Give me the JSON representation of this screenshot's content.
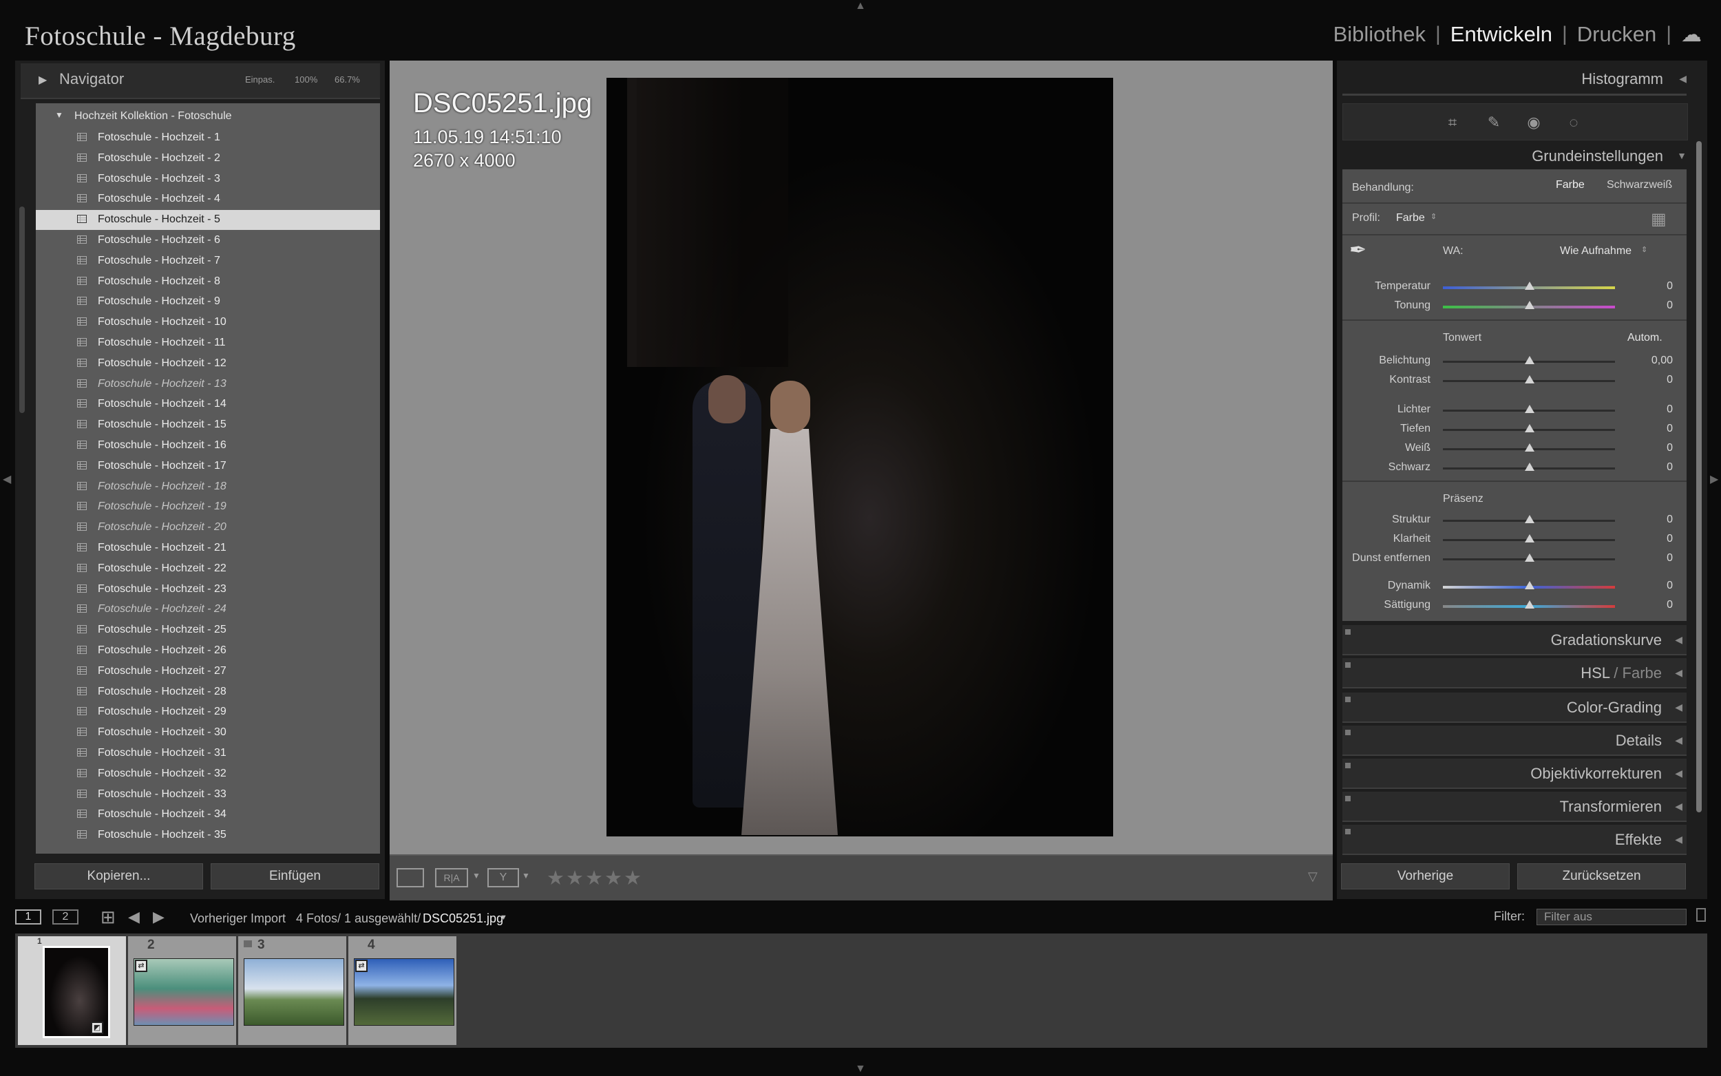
{
  "app_title": "Fotoschule - Magdeburg",
  "modules": [
    "Bibliothek",
    "Entwickeln",
    "Drucken"
  ],
  "active_module": "Entwickeln",
  "navigator": {
    "title": "Navigator",
    "zoom_options": [
      "Einpas.",
      "100%",
      "66.7%"
    ]
  },
  "collection": {
    "name": "Hochzeit Kollektion - Fotoschule",
    "items": [
      {
        "label": "Fotoschule - Hochzeit - 1",
        "italic": false
      },
      {
        "label": "Fotoschule - Hochzeit - 2",
        "italic": false
      },
      {
        "label": "Fotoschule - Hochzeit - 3",
        "italic": false
      },
      {
        "label": "Fotoschule - Hochzeit - 4",
        "italic": false
      },
      {
        "label": "Fotoschule - Hochzeit - 5",
        "italic": false,
        "selected": true
      },
      {
        "label": "Fotoschule - Hochzeit - 6",
        "italic": false
      },
      {
        "label": "Fotoschule - Hochzeit - 7",
        "italic": false
      },
      {
        "label": "Fotoschule - Hochzeit - 8",
        "italic": false
      },
      {
        "label": "Fotoschule - Hochzeit - 9",
        "italic": false
      },
      {
        "label": "Fotoschule - Hochzeit - 10",
        "italic": false
      },
      {
        "label": "Fotoschule - Hochzeit - 11",
        "italic": false
      },
      {
        "label": "Fotoschule - Hochzeit - 12",
        "italic": false
      },
      {
        "label": "Fotoschule - Hochzeit - 13",
        "italic": true
      },
      {
        "label": "Fotoschule - Hochzeit - 14",
        "italic": false
      },
      {
        "label": "Fotoschule - Hochzeit - 15",
        "italic": false
      },
      {
        "label": "Fotoschule - Hochzeit - 16",
        "italic": false
      },
      {
        "label": "Fotoschule - Hochzeit - 17",
        "italic": false
      },
      {
        "label": "Fotoschule - Hochzeit - 18",
        "italic": true
      },
      {
        "label": "Fotoschule - Hochzeit - 19",
        "italic": true
      },
      {
        "label": "Fotoschule - Hochzeit - 20",
        "italic": true
      },
      {
        "label": "Fotoschule - Hochzeit - 21",
        "italic": false
      },
      {
        "label": "Fotoschule - Hochzeit - 22",
        "italic": false
      },
      {
        "label": "Fotoschule - Hochzeit - 23",
        "italic": false
      },
      {
        "label": "Fotoschule - Hochzeit - 24",
        "italic": true
      },
      {
        "label": "Fotoschule - Hochzeit - 25",
        "italic": false
      },
      {
        "label": "Fotoschule - Hochzeit - 26",
        "italic": false
      },
      {
        "label": "Fotoschule - Hochzeit - 27",
        "italic": false
      },
      {
        "label": "Fotoschule - Hochzeit - 28",
        "italic": false
      },
      {
        "label": "Fotoschule - Hochzeit - 29",
        "italic": false
      },
      {
        "label": "Fotoschule - Hochzeit - 30",
        "italic": false
      },
      {
        "label": "Fotoschule - Hochzeit - 31",
        "italic": false
      },
      {
        "label": "Fotoschule - Hochzeit - 32",
        "italic": false
      },
      {
        "label": "Fotoschule - Hochzeit - 33",
        "italic": false
      },
      {
        "label": "Fotoschule - Hochzeit - 34",
        "italic": false
      },
      {
        "label": "Fotoschule - Hochzeit - 35",
        "italic": false
      }
    ]
  },
  "left_buttons": {
    "copy": "Kopieren...",
    "paste": "Einfügen"
  },
  "photo_info": {
    "filename": "DSC05251.jpg",
    "datetime": "11.05.19 14:51:10",
    "dimensions": "2670 x 4000"
  },
  "rating": {
    "stars": "★★★★★",
    "value": 0
  },
  "right_panel": {
    "histogram": "Histogramm",
    "basic_title": "Grundeinstellungen",
    "treatment_label": "Behandlung:",
    "treatment_options": [
      "Farbe",
      "Schwarzweiß"
    ],
    "profile_label": "Profil:",
    "profile_value": "Farbe",
    "wb_label": "WA:",
    "wb_value": "Wie Aufnahme",
    "tone_label": "Tonwert",
    "auto_label": "Autom.",
    "presence_label": "Präsenz",
    "sliders": [
      {
        "label": "Temperatur",
        "value": "0",
        "kind": "temp"
      },
      {
        "label": "Tonung",
        "value": "0",
        "kind": "tint"
      },
      {
        "label": "Belichtung",
        "value": "0,00",
        "kind": "gray"
      },
      {
        "label": "Kontrast",
        "value": "0",
        "kind": "gray"
      },
      {
        "label": "Lichter",
        "value": "0",
        "kind": "gray"
      },
      {
        "label": "Tiefen",
        "value": "0",
        "kind": "gray"
      },
      {
        "label": "Weiß",
        "value": "0",
        "kind": "gray"
      },
      {
        "label": "Schwarz",
        "value": "0",
        "kind": "gray"
      },
      {
        "label": "Struktur",
        "value": "0",
        "kind": "gray"
      },
      {
        "label": "Klarheit",
        "value": "0",
        "kind": "gray"
      },
      {
        "label": "Dunst entfernen",
        "value": "0",
        "kind": "gray"
      },
      {
        "label": "Dynamik",
        "value": "0",
        "kind": "vib"
      },
      {
        "label": "Sättigung",
        "value": "0",
        "kind": "sat"
      }
    ],
    "panels": [
      "Gradationskurve",
      "HSL",
      "Farbe",
      "Color-Grading",
      "Details",
      "Objektivkorrekturen",
      "Transformieren",
      "Effekte"
    ],
    "buttons": {
      "previous": "Vorherige",
      "reset": "Zurücksetzen"
    }
  },
  "filmbar": {
    "views": [
      "1",
      "2"
    ],
    "source": "Vorheriger Import",
    "count": "4 Fotos/ 1 ausgewählt/",
    "current_file": "DSC05251.jpg",
    "filter_label": "Filter:",
    "filter_value": "Filter aus"
  },
  "filmstrip": [
    {
      "number": "1",
      "selected": true
    },
    {
      "number": "2",
      "selected": false
    },
    {
      "number": "3",
      "selected": false
    },
    {
      "number": "4",
      "selected": false
    }
  ]
}
